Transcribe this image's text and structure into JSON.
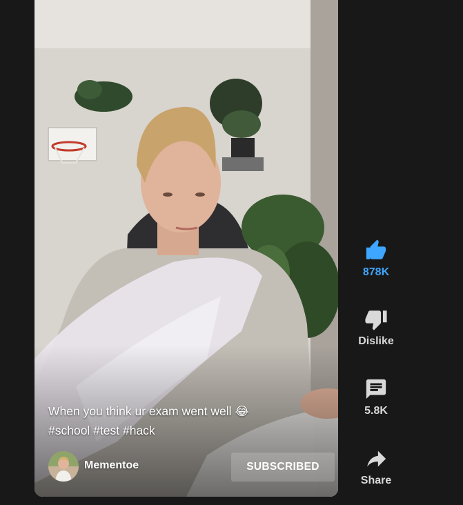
{
  "video": {
    "caption_line1": "When you think ur exam went well 😂",
    "caption_line2": "#school #test #hack",
    "channel_name": "Mementoe",
    "subscribe_label": "SUBSCRIBED"
  },
  "actions": {
    "like_count": "878K",
    "dislike_label": "Dislike",
    "comment_count": "5.8K",
    "share_label": "Share"
  },
  "colors": {
    "background": "#181818",
    "like_active": "#3ea6ff",
    "icon_default": "#d9d9d9"
  }
}
